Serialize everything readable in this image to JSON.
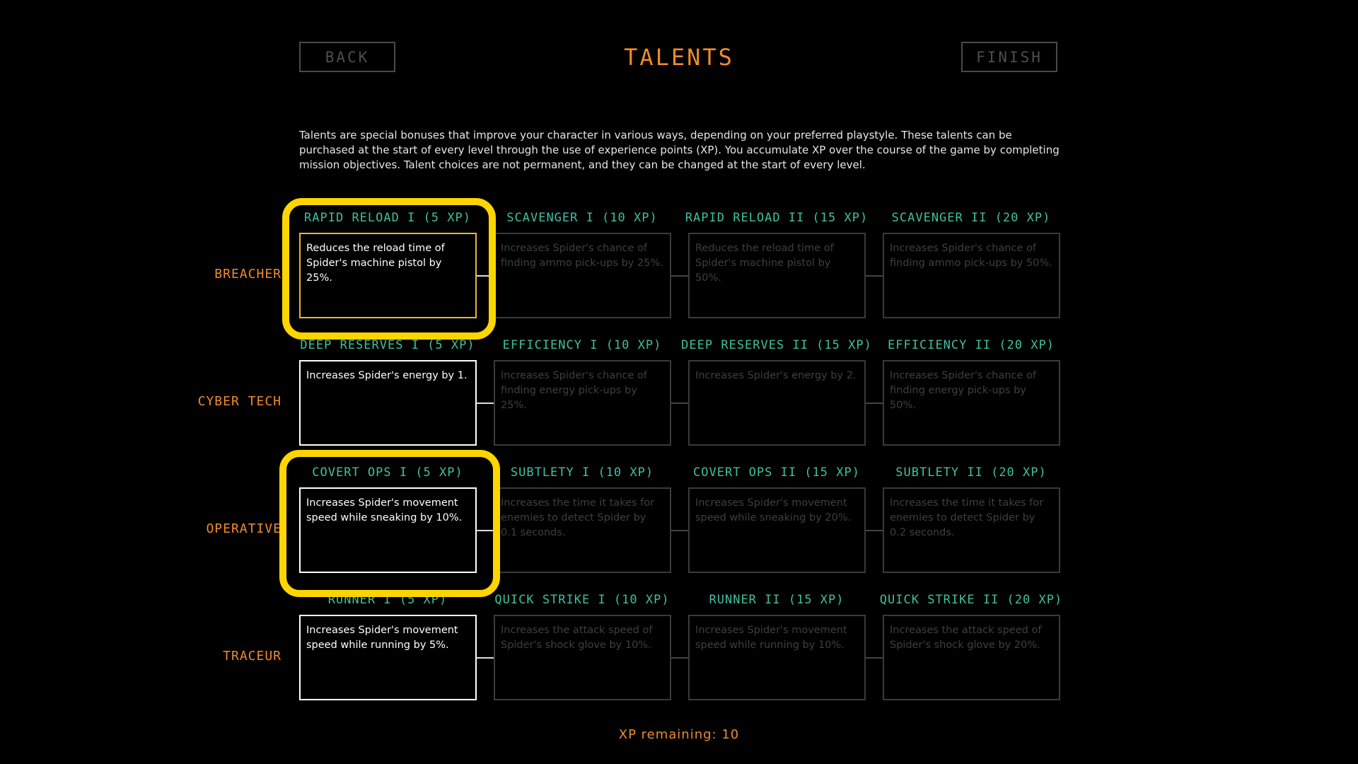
{
  "header": {
    "back_label": "BACK",
    "title": "TALENTS",
    "finish_label": "FINISH"
  },
  "intro_text": "Talents are special bonuses that improve your character in various ways, depending on your preferred playstyle. These talents can be purchased at the start of every level through the use of experience points (XP). You accumulate XP over the course of the game by completing mission objectives. Talent choices are not permanent, and they can be changed at the start of every level.",
  "rows": [
    {
      "label": "BREACHER",
      "talents": [
        {
          "name": "RAPID RELOAD I (5 XP)",
          "desc": "Reduces the reload time of Spider's machine pistol by 25%.",
          "state": "selected"
        },
        {
          "name": "SCAVENGER I (10 XP)",
          "desc": "Increases Spider's chance of finding ammo pick-ups by 25%.",
          "state": "locked"
        },
        {
          "name": "RAPID RELOAD II (15 XP)",
          "desc": "Reduces the reload time of Spider's machine pistol by 50%.",
          "state": "locked"
        },
        {
          "name": "SCAVENGER II (20 XP)",
          "desc": "Increases Spider's chance of finding ammo pick-ups by 50%.",
          "state": "locked"
        }
      ]
    },
    {
      "label": "CYBER TECH",
      "talents": [
        {
          "name": "DEEP RESERVES I (5 XP)",
          "desc": "Increases Spider's energy by 1.",
          "state": "active"
        },
        {
          "name": "EFFICIENCY I (10 XP)",
          "desc": "Increases Spider's chance of finding energy pick-ups by 25%.",
          "state": "locked"
        },
        {
          "name": "DEEP RESERVES II (15 XP)",
          "desc": "Increases Spider's energy by 2.",
          "state": "locked"
        },
        {
          "name": "EFFICIENCY II (20 XP)",
          "desc": "Increases Spider's chance of finding energy pick-ups by 50%.",
          "state": "locked"
        }
      ]
    },
    {
      "label": "OPERATIVE",
      "talents": [
        {
          "name": "COVERT OPS I (5 XP)",
          "desc": "Increases Spider's movement speed while sneaking by 10%.",
          "state": "active"
        },
        {
          "name": "SUBTLETY I (10 XP)",
          "desc": "Increases the time it takes for enemies to detect Spider by 0.1 seconds.",
          "state": "locked"
        },
        {
          "name": "COVERT OPS II (15 XP)",
          "desc": "Increases Spider's movement speed while sneaking by 20%.",
          "state": "locked"
        },
        {
          "name": "SUBTLETY II (20 XP)",
          "desc": "Increases the time it takes for enemies to detect Spider by 0.2 seconds.",
          "state": "locked"
        }
      ]
    },
    {
      "label": "TRACEUR",
      "talents": [
        {
          "name": "RUNNER I (5 XP)",
          "desc": "Increases Spider's movement speed while running by 5%.",
          "state": "active"
        },
        {
          "name": "QUICK STRIKE I (10 XP)",
          "desc": "Increases the attack speed of Spider's shock glove by 10%.",
          "state": "locked"
        },
        {
          "name": "RUNNER II (15 XP)",
          "desc": "Increases Spider's movement speed while running by 10%.",
          "state": "locked"
        },
        {
          "name": "QUICK STRIKE II (20 XP)",
          "desc": "Increases the attack speed of Spider's shock glove by 20%.",
          "state": "locked"
        }
      ]
    }
  ],
  "xp_remaining": "XP remaining: 10",
  "colors": {
    "accent_orange": "#ef8a2c",
    "talent_teal": "#3fc0a0",
    "highlight_yellow": "#ffd500"
  }
}
